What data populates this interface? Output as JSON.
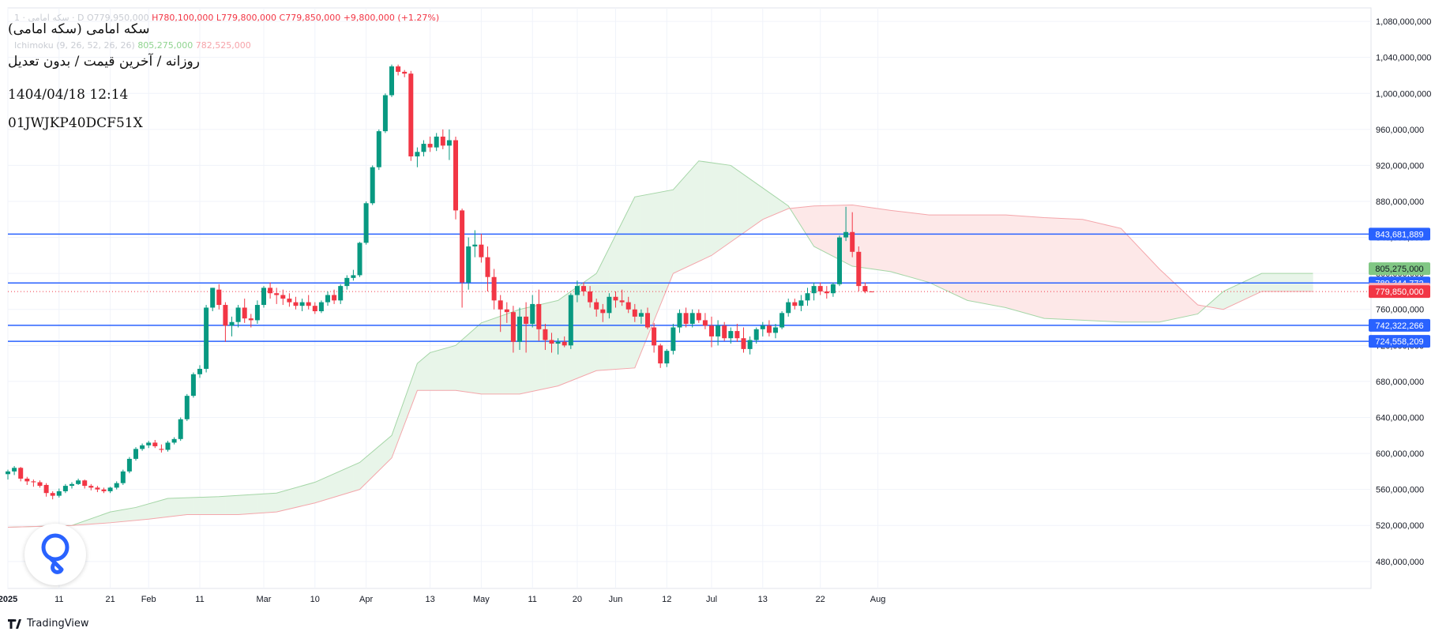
{
  "legend": {
    "symbol_short": "سکه امامی · 1 · D",
    "open": "O779,950,000",
    "high": "H780,100,000",
    "low": "L779,800,000",
    "close": "C779,850,000",
    "change": "+9,800,000 (+1.27%)",
    "ichimoku_name": "Ichimoku (9, 26, 52, 26, 26)",
    "ichimoku_a": "805,275,000",
    "ichimoku_b": "782,525,000"
  },
  "overlay": {
    "title": "سکه امامی (سکه امامی)",
    "subtitle": "روزانه / آخرین قیمت / بدون تعدیل",
    "timestamp": "1404/04/18 12:14",
    "id": "01JWJKP40DCF51X"
  },
  "brand": {
    "name": "TradingView"
  },
  "colors": {
    "up": "#089981",
    "down": "#f23645",
    "hline": "#2962ff",
    "cloud_bull": "#e8f5e9",
    "cloud_bear": "#fde8e8",
    "label_blue": "#2962ff",
    "label_green": "#81c784",
    "label_pink": "#f8b4b9",
    "label_red": "#f23645"
  },
  "chart_data": {
    "type": "candlestick",
    "y_axis": {
      "range": [
        450000000,
        1095000000
      ],
      "ticks": [
        480000000,
        520000000,
        560000000,
        600000000,
        640000000,
        680000000,
        720000000,
        760000000,
        800000000,
        840000000,
        880000000,
        920000000,
        960000000,
        1000000000,
        1040000000,
        1080000000
      ],
      "tick_labels": [
        "480,000,000",
        "520,000,000",
        "560,000,000",
        "600,000,000",
        "640,000,000",
        "680,000,000",
        "720,000,000",
        "760,000,000",
        "800,000,000",
        "840,000,000",
        "880,000,000",
        "920,000,000",
        "960,000,000",
        "1,000,000,000",
        "1,040,000,000",
        "1,080,000,000"
      ]
    },
    "x_axis": {
      "labels": [
        "2025",
        "11",
        "21",
        "Feb",
        "11",
        "Mar",
        "10",
        "Apr",
        "13",
        "May",
        "11",
        "20",
        "Jun",
        "12",
        "Jul",
        "13",
        "22",
        "Aug"
      ],
      "label_index": [
        0,
        8,
        16,
        22,
        30,
        40,
        48,
        56,
        66,
        74,
        82,
        89,
        95,
        103,
        110,
        118,
        127,
        136
      ]
    },
    "candles": [
      [
        577,
        582,
        571,
        580
      ],
      [
        580,
        586,
        576,
        584
      ],
      [
        584,
        585,
        569,
        572
      ],
      [
        572,
        574,
        565,
        569
      ],
      [
        569,
        571,
        563,
        568
      ],
      [
        568,
        570,
        562,
        564
      ],
      [
        565,
        567,
        552,
        556
      ],
      [
        556,
        558,
        549,
        553
      ],
      [
        553,
        561,
        551,
        558
      ],
      [
        558,
        566,
        556,
        564
      ],
      [
        564,
        568,
        561,
        566
      ],
      [
        566,
        572,
        565,
        570
      ],
      [
        570,
        571,
        561,
        564
      ],
      [
        564,
        566,
        559,
        562
      ],
      [
        562,
        564,
        557,
        560
      ],
      [
        560,
        562,
        556,
        558
      ],
      [
        558,
        563,
        556,
        562
      ],
      [
        562,
        569,
        560,
        567
      ],
      [
        567,
        582,
        565,
        580
      ],
      [
        580,
        596,
        578,
        594
      ],
      [
        594,
        607,
        592,
        605
      ],
      [
        605,
        611,
        603,
        609
      ],
      [
        609,
        614,
        606,
        612
      ],
      [
        612,
        615,
        606,
        608
      ],
      [
        605,
        610,
        601,
        604
      ],
      [
        604,
        614,
        602,
        612
      ],
      [
        612,
        618,
        610,
        616
      ],
      [
        616,
        640,
        614,
        638
      ],
      [
        638,
        666,
        636,
        664
      ],
      [
        664,
        690,
        662,
        688
      ],
      [
        688,
        698,
        684,
        694
      ],
      [
        694,
        765,
        690,
        762
      ],
      [
        762,
        784,
        758,
        784
      ],
      [
        782,
        788,
        760,
        765
      ],
      [
        765,
        768,
        724,
        742
      ],
      [
        742,
        752,
        730,
        746
      ],
      [
        746,
        765,
        740,
        762
      ],
      [
        762,
        772,
        745,
        750
      ],
      [
        750,
        755,
        740,
        748
      ],
      [
        748,
        770,
        744,
        765
      ],
      [
        765,
        786,
        762,
        784
      ],
      [
        784,
        790,
        772,
        778
      ],
      [
        778,
        784,
        766,
        776
      ],
      [
        776,
        782,
        765,
        772
      ],
      [
        772,
        778,
        763,
        768
      ],
      [
        768,
        774,
        760,
        764
      ],
      [
        764,
        772,
        758,
        768
      ],
      [
        768,
        776,
        760,
        764
      ],
      [
        764,
        768,
        755,
        758
      ],
      [
        758,
        770,
        756,
        768
      ],
      [
        768,
        780,
        764,
        776
      ],
      [
        776,
        782,
        766,
        770
      ],
      [
        770,
        788,
        766,
        786
      ],
      [
        786,
        798,
        782,
        795
      ],
      [
        795,
        804,
        792,
        798
      ],
      [
        798,
        835,
        796,
        834
      ],
      [
        834,
        880,
        832,
        878
      ],
      [
        878,
        920,
        876,
        918
      ],
      [
        918,
        960,
        915,
        958
      ],
      [
        958,
        1000,
        956,
        998
      ],
      [
        998,
        1032,
        996,
        1030
      ],
      [
        1030,
        1032,
        1020,
        1024
      ],
      [
        1024,
        1026,
        1018,
        1022
      ],
      [
        1022,
        1025,
        925,
        930
      ],
      [
        930,
        940,
        918,
        935
      ],
      [
        935,
        948,
        930,
        944
      ],
      [
        944,
        952,
        935,
        940
      ],
      [
        940,
        956,
        936,
        952
      ],
      [
        952,
        960,
        938,
        942
      ],
      [
        942,
        960,
        926,
        948
      ],
      [
        948,
        952,
        860,
        870
      ],
      [
        870,
        872,
        762,
        790
      ],
      [
        790,
        840,
        782,
        830
      ],
      [
        830,
        848,
        818,
        832
      ],
      [
        832,
        844,
        812,
        818
      ],
      [
        818,
        830,
        780,
        796
      ],
      [
        796,
        805,
        760,
        770
      ],
      [
        770,
        776,
        735,
        760
      ],
      [
        760,
        768,
        745,
        757
      ],
      [
        757,
        764,
        712,
        724
      ],
      [
        724,
        762,
        715,
        752
      ],
      [
        752,
        768,
        712,
        744
      ],
      [
        744,
        776,
        740,
        766
      ],
      [
        766,
        782,
        725,
        738
      ],
      [
        738,
        744,
        715,
        726
      ],
      [
        726,
        734,
        712,
        722
      ],
      [
        722,
        728,
        710,
        724
      ],
      [
        724,
        730,
        718,
        720
      ],
      [
        720,
        778,
        716,
        776
      ],
      [
        776,
        792,
        768,
        786
      ],
      [
        786,
        790,
        775,
        780
      ],
      [
        780,
        786,
        762,
        768
      ],
      [
        768,
        772,
        752,
        760
      ],
      [
        760,
        766,
        746,
        756
      ],
      [
        756,
        778,
        750,
        774
      ],
      [
        774,
        780,
        762,
        770
      ],
      [
        770,
        782,
        764,
        768
      ],
      [
        768,
        774,
        756,
        760
      ],
      [
        760,
        766,
        746,
        752
      ],
      [
        752,
        760,
        744,
        756
      ],
      [
        756,
        762,
        738,
        740
      ],
      [
        740,
        745,
        712,
        720
      ],
      [
        720,
        722,
        695,
        700
      ],
      [
        700,
        716,
        696,
        714
      ],
      [
        714,
        744,
        710,
        740
      ],
      [
        740,
        760,
        734,
        756
      ],
      [
        756,
        762,
        740,
        744
      ],
      [
        744,
        760,
        740,
        756
      ],
      [
        756,
        760,
        745,
        748
      ],
      [
        748,
        756,
        738,
        742
      ],
      [
        742,
        752,
        718,
        730
      ],
      [
        730,
        748,
        720,
        742
      ],
      [
        742,
        746,
        725,
        728
      ],
      [
        728,
        740,
        722,
        736
      ],
      [
        736,
        744,
        724,
        728
      ],
      [
        728,
        740,
        712,
        716
      ],
      [
        716,
        730,
        710,
        726
      ],
      [
        726,
        740,
        722,
        738
      ],
      [
        738,
        746,
        730,
        742
      ],
      [
        742,
        748,
        730,
        734
      ],
      [
        734,
        744,
        728,
        740
      ],
      [
        740,
        758,
        738,
        756
      ],
      [
        756,
        772,
        752,
        768
      ],
      [
        768,
        772,
        760,
        764
      ],
      [
        764,
        776,
        758,
        770
      ],
      [
        770,
        784,
        764,
        778
      ],
      [
        778,
        790,
        770,
        786
      ],
      [
        786,
        790,
        776,
        780
      ],
      [
        780,
        786,
        772,
        778
      ],
      [
        778,
        790,
        774,
        788
      ],
      [
        788,
        842,
        786,
        840
      ],
      [
        840,
        874,
        836,
        846
      ],
      [
        846,
        868,
        818,
        824
      ],
      [
        824,
        830,
        780,
        786
      ],
      [
        786,
        790,
        778,
        780
      ],
      [
        779.95,
        780.1,
        779.8,
        779.85
      ]
    ],
    "horizontal_levels": [
      843681889,
      789344772,
      742322266,
      724558209
    ],
    "price_labels": [
      {
        "value": 843681889,
        "text": "843,681,889",
        "style": "blue"
      },
      {
        "value": 805275000,
        "text": "805,275,000",
        "style": "green"
      },
      {
        "value": 789344772,
        "text": "789,344,772",
        "style": "blue"
      },
      {
        "value": 782525000,
        "text": "782,525,000",
        "style": "pink"
      },
      {
        "value": 779850000,
        "text": "779,850,000",
        "style": "red"
      },
      {
        "value": 742322266,
        "text": "742,322,266",
        "style": "blue"
      },
      {
        "value": 724558209,
        "text": "724,558,209",
        "style": "blue"
      }
    ],
    "ichimoku": {
      "span_a": [
        [
          0,
          518
        ],
        [
          10,
          520
        ],
        [
          16,
          535
        ],
        [
          20,
          540
        ],
        [
          25,
          550
        ],
        [
          33,
          552
        ],
        [
          42,
          556
        ],
        [
          48,
          568
        ],
        [
          55,
          590
        ],
        [
          60,
          620
        ],
        [
          64,
          700
        ],
        [
          66,
          712
        ],
        [
          70,
          720
        ],
        [
          74,
          745
        ],
        [
          80,
          760
        ],
        [
          86,
          770
        ],
        [
          92,
          800
        ],
        [
          98,
          885
        ],
        [
          104,
          893
        ],
        [
          108,
          925
        ],
        [
          113,
          920
        ],
        [
          118,
          895
        ],
        [
          122,
          875
        ],
        [
          126,
          830
        ],
        [
          132,
          808
        ],
        [
          138,
          802
        ],
        [
          144,
          790
        ],
        [
          150,
          770
        ],
        [
          156,
          762
        ],
        [
          162,
          750
        ],
        [
          168,
          748
        ],
        [
          174,
          746
        ],
        [
          180,
          746
        ],
        [
          186,
          755
        ],
        [
          190,
          780
        ],
        [
          196,
          800
        ],
        [
          204,
          800
        ]
      ],
      "span_b": [
        [
          0,
          518
        ],
        [
          10,
          520
        ],
        [
          16,
          523
        ],
        [
          22,
          527
        ],
        [
          28,
          532
        ],
        [
          36,
          532
        ],
        [
          42,
          535
        ],
        [
          48,
          545
        ],
        [
          55,
          560
        ],
        [
          60,
          595
        ],
        [
          64,
          670
        ],
        [
          70,
          670
        ],
        [
          74,
          666
        ],
        [
          80,
          666
        ],
        [
          86,
          675
        ],
        [
          92,
          692
        ],
        [
          98,
          695
        ],
        [
          104,
          800
        ],
        [
          110,
          820
        ],
        [
          118,
          860
        ],
        [
          122,
          872
        ],
        [
          126,
          875
        ],
        [
          132,
          876
        ],
        [
          138,
          870
        ],
        [
          144,
          865
        ],
        [
          150,
          865
        ],
        [
          156,
          865
        ],
        [
          162,
          862
        ],
        [
          168,
          860
        ],
        [
          174,
          850
        ],
        [
          180,
          805
        ],
        [
          186,
          765
        ],
        [
          190,
          760
        ],
        [
          196,
          780
        ],
        [
          204,
          780
        ]
      ]
    }
  }
}
